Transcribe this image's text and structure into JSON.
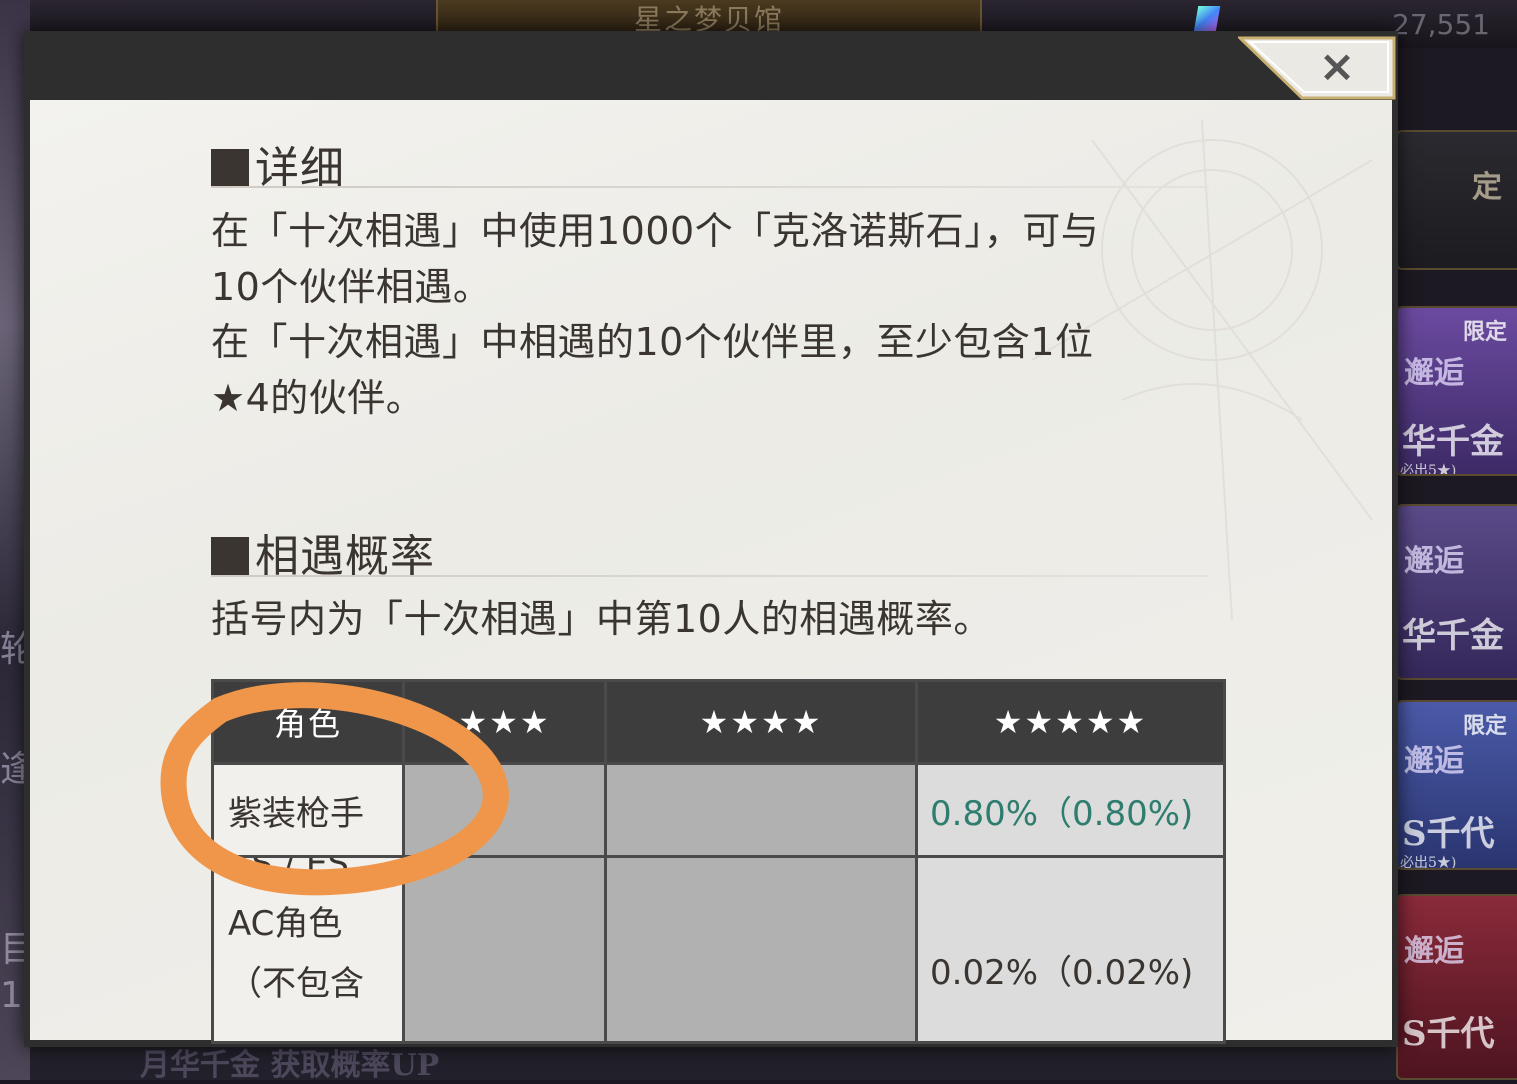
{
  "background": {
    "banner_title": "星之梦贝馆",
    "coin_count": "27,551",
    "bottom_text": "月华千金 获取概率UP",
    "left_texts": [
      "轮",
      "逢",
      "目",
      "1"
    ],
    "side_cards": [
      {
        "text1": "定",
        "text2": "",
        "tag": "",
        "note": ""
      },
      {
        "text1": "邂逅",
        "text2": "华千金",
        "tag": "限定",
        "note": "必出5★)"
      },
      {
        "text1": "邂逅",
        "text2": "华千金",
        "tag": "",
        "note": ""
      },
      {
        "text1": "邂逅",
        "text2": "S千代",
        "tag": "限定",
        "note": "必出5★)"
      },
      {
        "text1": "邂逅",
        "text2": "S千代",
        "tag": "",
        "note": ""
      }
    ]
  },
  "modal": {
    "close_label": "×",
    "details": {
      "title": "详细",
      "paragraph": "在「十次相遇」中使用1000个「克洛诺斯石」，可与10个伙伴相遇。在「十次相遇」中相遇的10个伙伴里，至少包含1位★4的伙伴。",
      "lines": [
        "在「十次相遇」中使用1000个「克洛诺斯石」，可与",
        "10个伙伴相遇。",
        "在「十次相遇」中相遇的10个伙伴里，至少包含1位",
        "★4的伙伴。"
      ]
    },
    "rates": {
      "title": "相遇概率",
      "note": "括号内为「十次相遇」中第10人的相遇概率。",
      "table": {
        "headers": [
          "角色",
          "★★★",
          "★★★★",
          "★★★★★"
        ],
        "rows": [
          {
            "name": "紫装枪手",
            "star3": "",
            "star4": "",
            "star5": "0.80%（0.80%)"
          },
          {
            "name_lines": [
              "AS / ES、",
              "AC角色",
              "（不包含"
            ],
            "star3": "",
            "star4": "",
            "star5": "0.02%（0.02%)"
          }
        ]
      }
    }
  },
  "colors": {
    "accent_green": "#2e7d6e",
    "annotation_orange": "#f0964a",
    "table_header": "#3d3d3d"
  }
}
